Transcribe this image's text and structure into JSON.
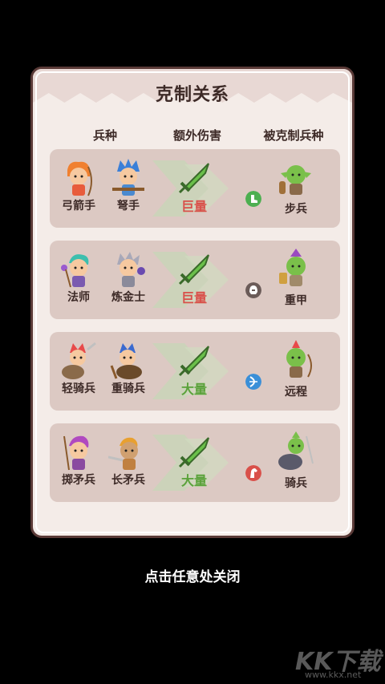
{
  "dialog": {
    "title": "克制关系",
    "col_unit": "兵种",
    "col_damage": "额外伤害",
    "col_countered": "被克制兵种"
  },
  "rows": [
    {
      "units": [
        "弓箭手",
        "弩手"
      ],
      "amount": "巨量",
      "amount_color": "#d9504a",
      "target": "步兵",
      "badge_icon": "boot-icon",
      "badge_color": "#4caf50"
    },
    {
      "units": [
        "法师",
        "炼金士"
      ],
      "amount": "巨量",
      "amount_color": "#d9504a",
      "target": "重甲",
      "badge_icon": "helmet-icon",
      "badge_color": "#6b5b58"
    },
    {
      "units": [
        "轻骑兵",
        "重骑兵"
      ],
      "amount": "大量",
      "amount_color": "#5aa23a",
      "target": "远程",
      "badge_icon": "bow-icon",
      "badge_color": "#3a8fd8"
    },
    {
      "units": [
        "掷矛兵",
        "长矛兵"
      ],
      "amount": "大量",
      "amount_color": "#5aa23a",
      "target": "骑兵",
      "badge_icon": "horse-icon",
      "badge_color": "#d9504a"
    }
  ],
  "footer": {
    "close_hint": "点击任意处关闭"
  },
  "watermark": {
    "main": "KK下载",
    "sub": "www.kkx.net"
  }
}
